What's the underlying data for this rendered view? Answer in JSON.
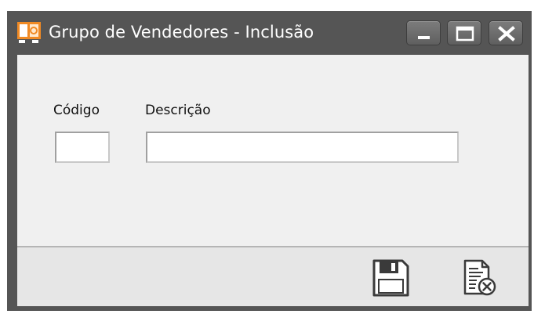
{
  "window": {
    "title": "Grupo de Vendedores - Inclusão",
    "app_icon": "document-app-icon",
    "controls": {
      "minimize": "minimize-icon",
      "maximize": "maximize-icon",
      "close": "close-icon"
    }
  },
  "form": {
    "codigo_label": "Código",
    "codigo_value": "",
    "descricao_label": "Descrição",
    "descricao_value": ""
  },
  "toolbar": {
    "save_icon": "floppy-disk-icon",
    "cancel_icon": "document-cancel-icon"
  },
  "colors": {
    "titlebar": "#555555",
    "content_bg": "#f0f0f0",
    "footer_bg": "#e6e6e6",
    "accent_icon": "#f08a24"
  }
}
